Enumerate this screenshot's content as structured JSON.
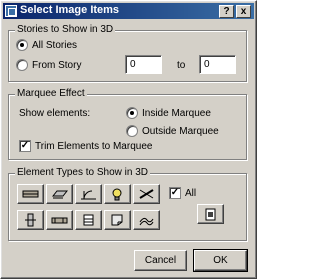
{
  "window": {
    "title": "Select Image Items",
    "help_label": "?",
    "close_label": "x"
  },
  "stories": {
    "legend": "Stories to Show in 3D",
    "all_label": "All Stories",
    "from_label": "From Story",
    "from_value": "0",
    "to_label": "to",
    "to_value": "0",
    "selected": "all"
  },
  "marquee": {
    "legend": "Marquee Effect",
    "show_label": "Show elements:",
    "inside_label": "Inside Marquee",
    "outside_label": "Outside Marquee",
    "selected": "inside",
    "trim_label": "Trim Elements to Marquee",
    "trim_checked": true
  },
  "elements": {
    "legend": "Element Types to Show in 3D",
    "all_label": "All",
    "all_checked": true,
    "row1_icons": [
      "wall-icon",
      "slab-icon",
      "door-window-icon",
      "lamp-icon",
      "beam-icon"
    ],
    "row2_icons": [
      "column-icon",
      "roof-icon",
      "stair-object-icon",
      "zone-icon",
      "mesh-icon"
    ],
    "extra_icon": "library-part-icon"
  },
  "footer": {
    "cancel_label": "Cancel",
    "ok_label": "OK"
  }
}
